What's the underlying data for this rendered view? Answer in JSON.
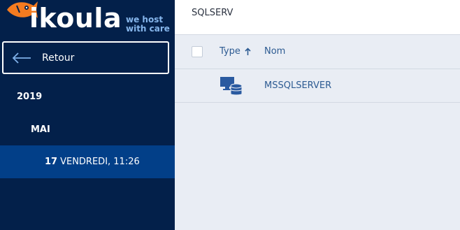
{
  "brand": {
    "name": "ikoula",
    "tagline_line1": "we host",
    "tagline_line2": "with care",
    "accent_color": "#f47b20"
  },
  "sidebar": {
    "back_label": "Retour",
    "year": "2019",
    "month": "MAI",
    "day_number": "17",
    "day_label": "VENDREDI, 11:26",
    "background": "#03204a",
    "selected_background": "#023f88"
  },
  "main": {
    "breadcrumb": "SQLSERV",
    "columns": {
      "type": "Type",
      "name": "Nom"
    },
    "sort": "type-ascending",
    "rows": [
      {
        "icon": "sql-server-icon",
        "name": "MSSQLSERVER"
      }
    ],
    "link_color": "#2d5b92"
  }
}
